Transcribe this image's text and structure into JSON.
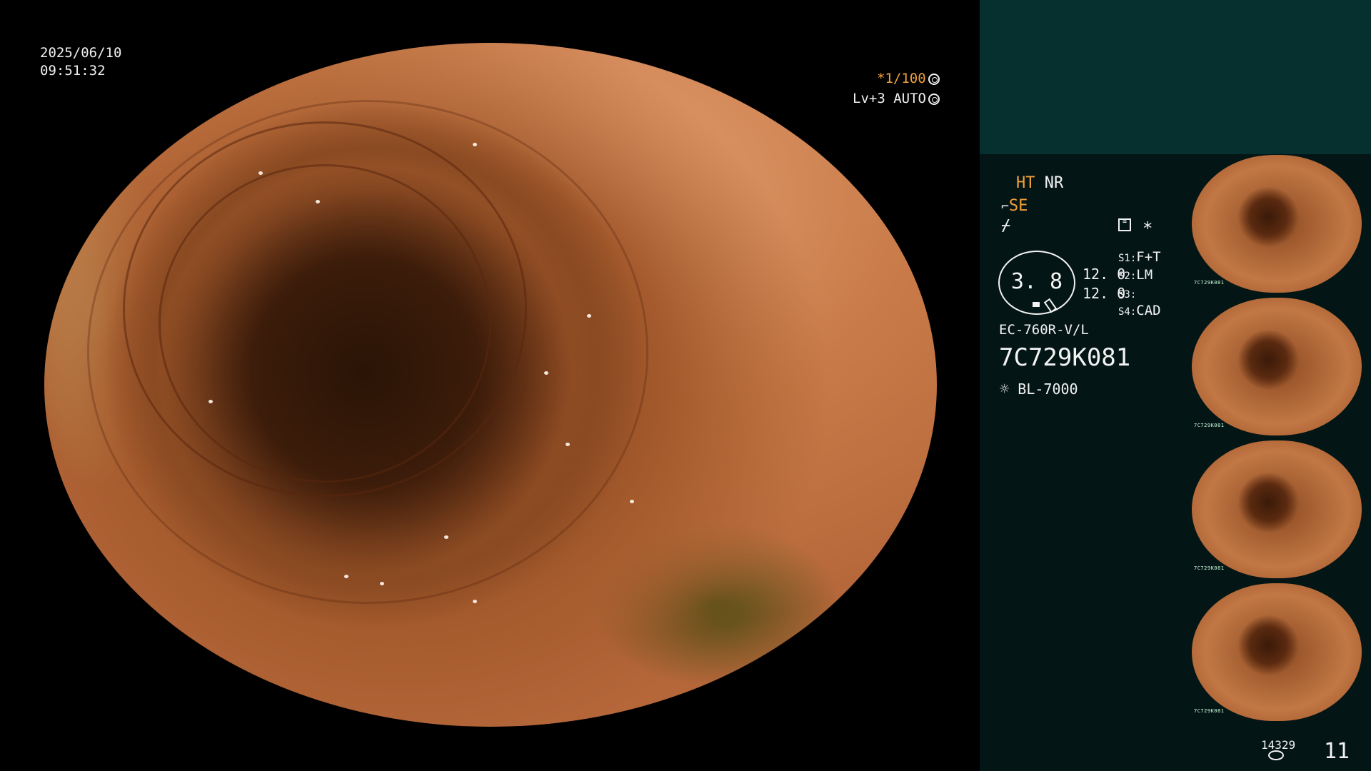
{
  "scope_overlay": {
    "date": "2025/06/10",
    "time": "09:51:32",
    "shutter_star": "*",
    "shutter_value": "1/100",
    "shutter_icon": "aperture-icon",
    "light_level": "Lv+3",
    "light_mode": "AUTO",
    "light_icon": "iris-icon"
  },
  "panel": {
    "ht": "HT",
    "nr": "NR",
    "se": "SE",
    "se_icon": "scope-tip-icon",
    "freeze_icon": "freeze-icon",
    "memo_icon": "settings-list-icon",
    "asterisk": "*",
    "gauge_value": "3. 8",
    "value_1": "12. 0",
    "value_2": "12. 0",
    "switches": [
      {
        "key": "S1:",
        "value": "F+T"
      },
      {
        "key": "S2:",
        "value": "LM"
      },
      {
        "key": "S3:",
        "value": ""
      },
      {
        "key": "S4:",
        "value": "CAD"
      }
    ],
    "scope_model": "EC-760R-V/L",
    "serial": "7C729K081",
    "light_source_icon": "lamp-icon",
    "light_source": "BL-7000",
    "thumb_caption": "7C729K081",
    "storage_count": "14329",
    "storage_icon": "disk-icon",
    "image_count": "11"
  }
}
